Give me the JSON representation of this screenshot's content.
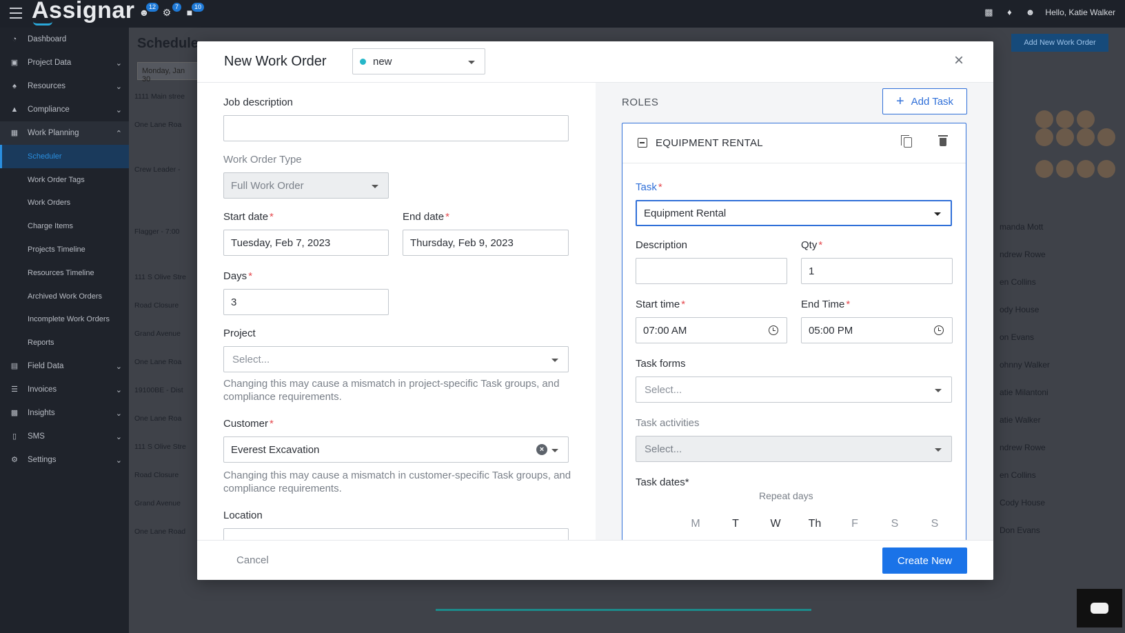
{
  "app": {
    "logo": "Assignar"
  },
  "topbar": {
    "badges": [
      "12",
      "7",
      "10"
    ],
    "greeting": "Hello, Katie Walker"
  },
  "sidebar": {
    "items": [
      {
        "label": "Dashboard",
        "icon": "dashboard-icon"
      },
      {
        "label": "Project Data",
        "icon": "database-icon"
      },
      {
        "label": "Resources",
        "icon": "resources-icon"
      },
      {
        "label": "Compliance",
        "icon": "compliance-icon"
      },
      {
        "label": "Work Planning",
        "icon": "calendar-icon"
      }
    ],
    "subitems": [
      "Scheduler",
      "Work Order Tags",
      "Work Orders",
      "Charge Items",
      "Projects Timeline",
      "Resources Timeline",
      "Archived Work Orders",
      "Incomplete Work Orders",
      "Reports"
    ],
    "items_bottom": [
      {
        "label": "Field Data",
        "icon": "form-icon"
      },
      {
        "label": "Invoices",
        "icon": "list-icon"
      },
      {
        "label": "Insights",
        "icon": "chart-icon"
      },
      {
        "label": "SMS",
        "icon": "phone-icon"
      },
      {
        "label": "Settings",
        "icon": "gear-icon"
      }
    ]
  },
  "background": {
    "title": "Schedule",
    "date": "Monday, Jan 30",
    "add_button": "Add New Work Order",
    "rows": [
      "1111 Main stree",
      "One Lane Roa",
      "Crew Leader -",
      "Flagger - 7:00",
      "111 S Olive Stre",
      "Road Closure",
      "Grand Avenue",
      "One Lane Roa",
      "19100BE - Dist",
      "One Lane Roa",
      "111 S Olive Stre",
      "Road Closure",
      "Grand Avenue",
      "One Lane Road"
    ],
    "names": [
      "manda Mott",
      "ndrew Rowe",
      "en Collins",
      "ody House",
      "on Evans",
      "ohnny Walker",
      "atie Milantoni",
      "atie Walker",
      "ndrew Rowe",
      "en Collins",
      "Cody House",
      "Don Evans"
    ]
  },
  "modal": {
    "title": "New Work Order",
    "status": "new",
    "status_color": "#26b7c9",
    "left": {
      "job_description_label": "Job description",
      "job_description_value": "",
      "work_order_type_label": "Work Order Type",
      "work_order_type_value": "Full Work Order",
      "start_date_label": "Start date",
      "start_date_value": "Tuesday, Feb 7, 2023",
      "end_date_label": "End date",
      "end_date_value": "Thursday, Feb 9, 2023",
      "days_label": "Days",
      "days_value": "3",
      "project_label": "Project",
      "project_placeholder": "Select...",
      "project_hint": "Changing this may cause a mismatch in project-specific Task groups, and compliance requirements.",
      "customer_label": "Customer",
      "customer_value": "Everest Excavation",
      "customer_hint": "Changing this may cause a mismatch in customer-specific Task groups, and compliance requirements.",
      "location_label": "Location"
    },
    "right": {
      "roles_label": "ROLES",
      "add_task": "Add Task",
      "card_title": "EQUIPMENT RENTAL",
      "task_label": "Task",
      "task_value": "Equipment Rental",
      "description_label": "Description",
      "description_value": "",
      "qty_label": "Qty",
      "qty_value": "1",
      "start_time_label": "Start time",
      "start_time_value": "07:00 AM",
      "end_time_label": "End Time",
      "end_time_value": "05:00 PM",
      "task_forms_label": "Task forms",
      "task_forms_placeholder": "Select...",
      "task_activities_label": "Task activities",
      "task_activities_placeholder": "Select...",
      "task_dates_label": "Task dates",
      "repeat_days_label": "Repeat days",
      "days": [
        "M",
        "T",
        "W",
        "Th",
        "F",
        "S",
        "S"
      ]
    },
    "footer": {
      "cancel": "Cancel",
      "create": "Create New"
    }
  }
}
